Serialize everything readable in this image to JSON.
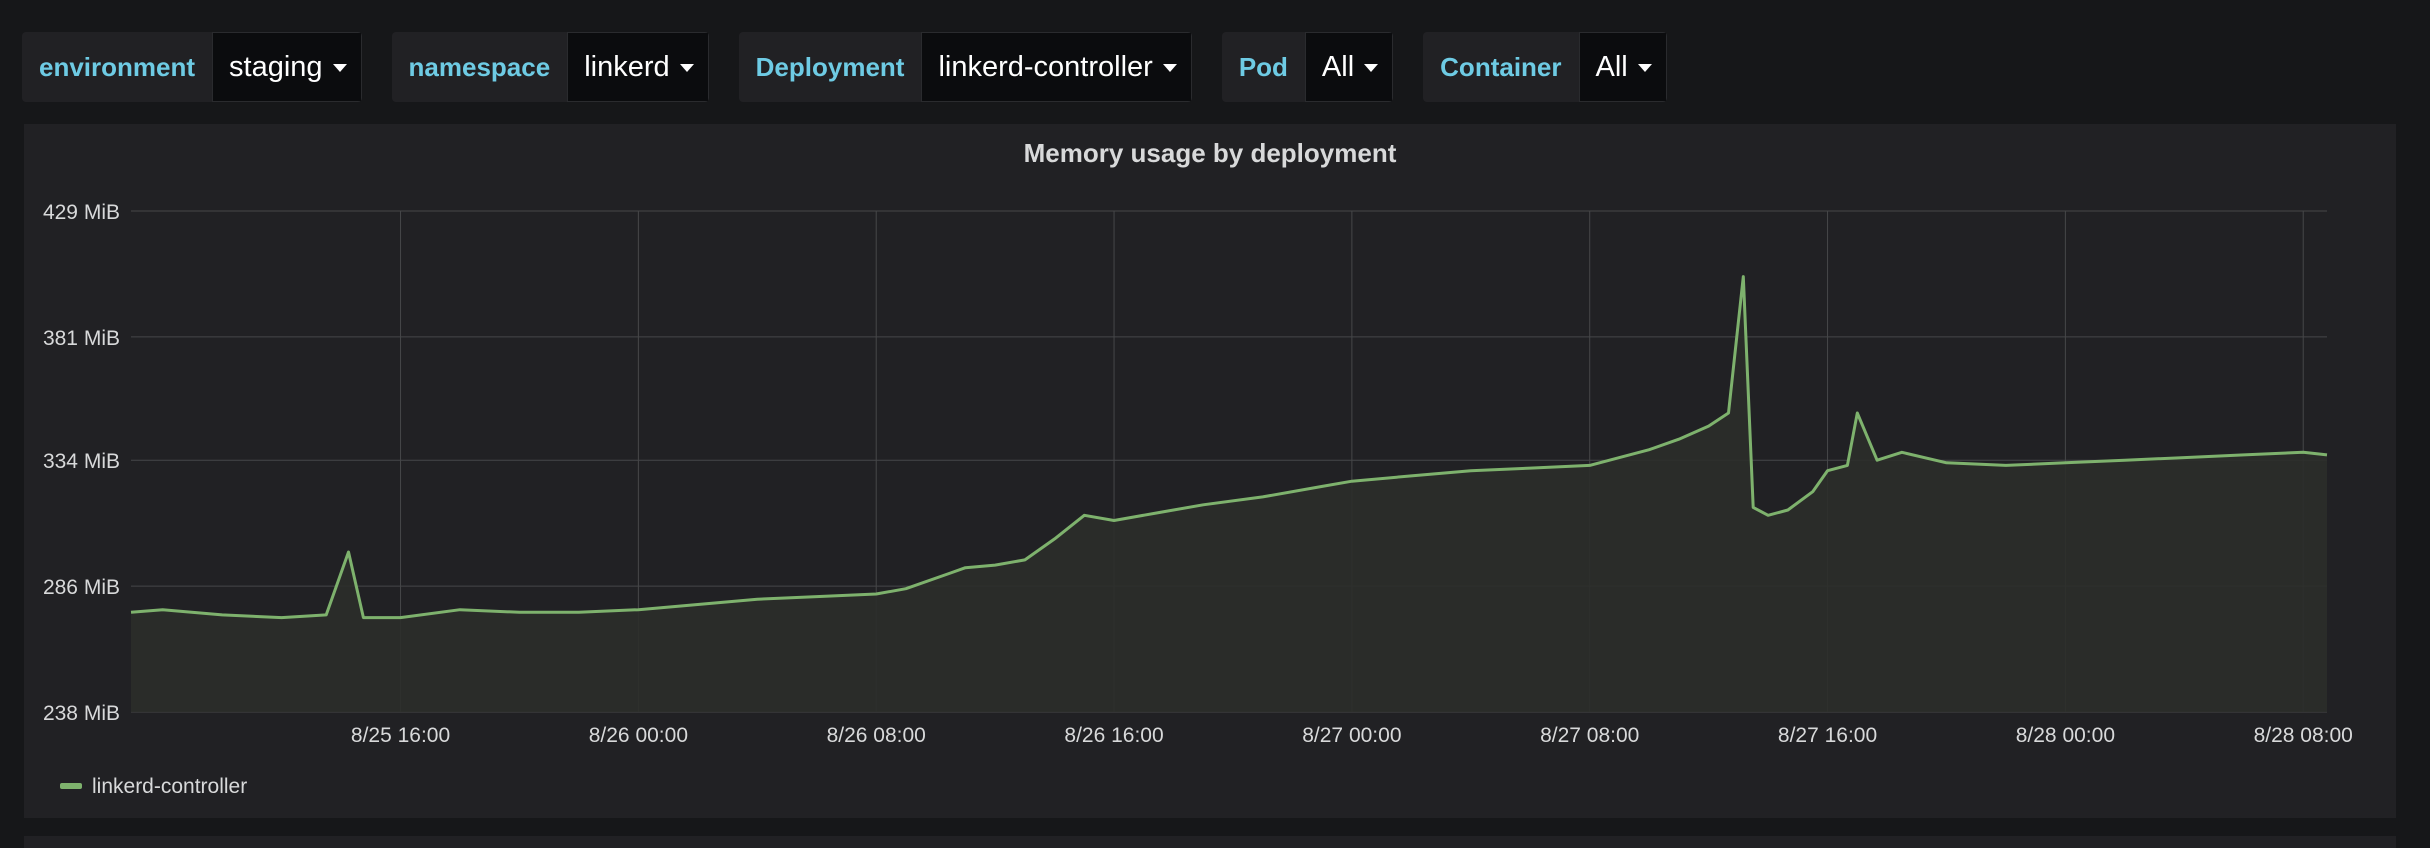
{
  "variables": [
    {
      "label": "environment",
      "value": "staging"
    },
    {
      "label": "namespace",
      "value": "linkerd"
    },
    {
      "label": "Deployment",
      "value": "linkerd-controller"
    },
    {
      "label": "Pod",
      "value": "All"
    },
    {
      "label": "Container",
      "value": "All"
    }
  ],
  "colors": {
    "background": "#161719",
    "panel": "#212124",
    "series_line": "#7eb26d",
    "series_fill": "#2b2d2a",
    "grid": "#464749",
    "variable_label": "#6ecbe4"
  },
  "chart_data": {
    "type": "line",
    "title": "Memory usage by deployment",
    "xlabel": "",
    "ylabel": "",
    "x_range": [
      "8/25 06:56",
      "8/28 08:48"
    ],
    "ylim": [
      238,
      429
    ],
    "yticks": [
      238,
      286,
      334,
      381,
      429
    ],
    "ytick_labels": [
      "238 MiB",
      "286 MiB",
      "334 MiB",
      "381 MiB",
      "429 MiB"
    ],
    "xticks": [
      "8/25 16:00",
      "8/26 00:00",
      "8/26 08:00",
      "8/26 16:00",
      "8/27 00:00",
      "8/27 08:00",
      "8/27 16:00",
      "8/28 00:00",
      "8/28 08:00"
    ],
    "grid": true,
    "legend": "bottom-left",
    "series": [
      {
        "name": "linkerd-controller",
        "unit": "MiB",
        "x": [
          "8/25 06:56",
          "8/25 08:00",
          "8/25 10:00",
          "8/25 12:00",
          "8/25 13:30",
          "8/25 14:15",
          "8/25 14:45",
          "8/25 16:00",
          "8/25 18:00",
          "8/25 20:00",
          "8/25 22:00",
          "8/26 00:00",
          "8/26 02:00",
          "8/26 04:00",
          "8/26 06:00",
          "8/26 08:00",
          "8/26 09:00",
          "8/26 10:30",
          "8/26 11:00",
          "8/26 12:00",
          "8/26 13:00",
          "8/26 14:00",
          "8/26 15:00",
          "8/26 16:00",
          "8/26 17:30",
          "8/26 19:00",
          "8/26 21:00",
          "8/26 23:00",
          "8/27 00:00",
          "8/27 02:00",
          "8/27 04:00",
          "8/27 06:00",
          "8/27 08:00",
          "8/27 09:00",
          "8/27 10:00",
          "8/27 11:00",
          "8/27 12:00",
          "8/27 12:40",
          "8/27 13:10",
          "8/27 13:30",
          "8/27 14:00",
          "8/27 14:40",
          "8/27 15:30",
          "8/27 16:00",
          "8/27 16:40",
          "8/27 17:00",
          "8/27 17:40",
          "8/27 18:30",
          "8/27 20:00",
          "8/27 22:00",
          "8/28 00:00",
          "8/28 02:00",
          "8/28 04:00",
          "8/28 06:00",
          "8/28 08:00",
          "8/28 08:48"
        ],
        "values": [
          276,
          277,
          275,
          274,
          275,
          299,
          274,
          274,
          277,
          276,
          276,
          277,
          279,
          281,
          282,
          283,
          285,
          291,
          293,
          294,
          296,
          304,
          313,
          311,
          314,
          317,
          320,
          324,
          326,
          328,
          330,
          331,
          332,
          335,
          338,
          342,
          347,
          352,
          404,
          316,
          313,
          315,
          322,
          330,
          332,
          352,
          334,
          337,
          333,
          332,
          333,
          334,
          335,
          336,
          337,
          336
        ]
      }
    ]
  }
}
